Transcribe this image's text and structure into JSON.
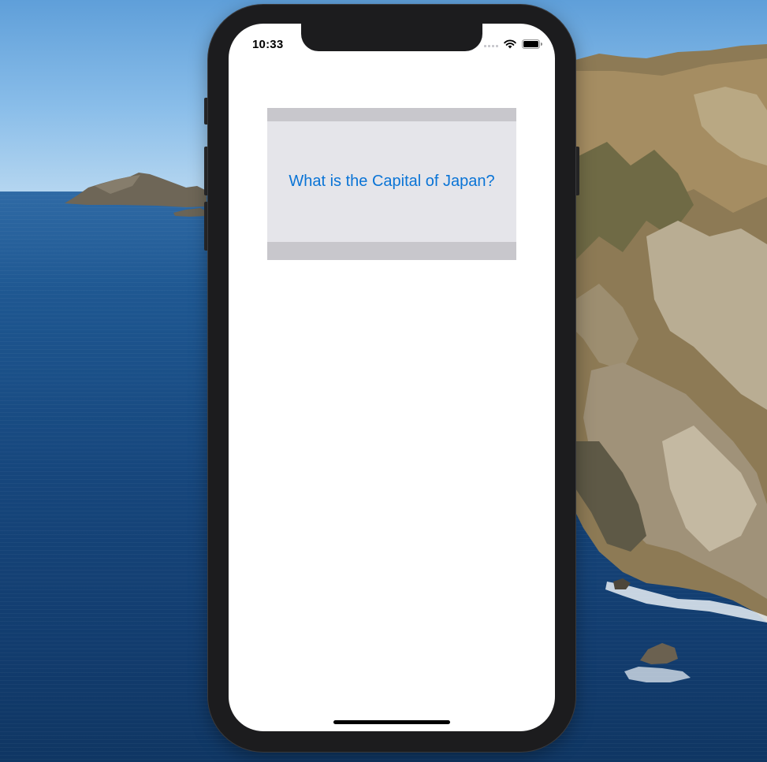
{
  "status_bar": {
    "time": "10:33"
  },
  "quiz": {
    "question": "What is the Capital of Japan?"
  },
  "theme": {
    "accent": "#0a74d6",
    "card_outer": "#c8c7cc",
    "card_inner": "#e5e5ea",
    "screen_bg": "#ffffff",
    "phone_frame": "#1c1c1e"
  },
  "icons": [
    "signal-icon",
    "wifi-icon",
    "battery-icon"
  ]
}
